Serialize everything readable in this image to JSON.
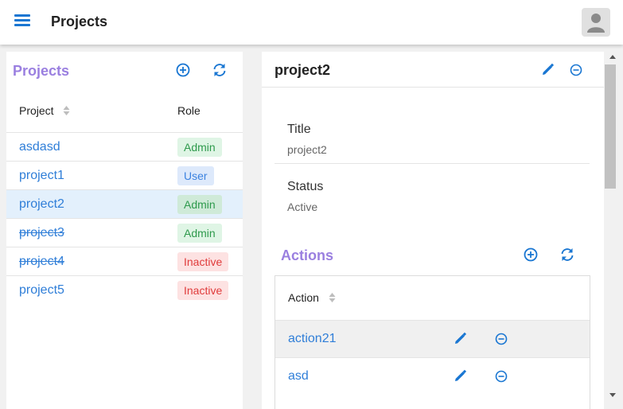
{
  "header": {
    "menu_icon": "hamburger-menu-icon",
    "title": "Projects",
    "avatar_icon": "user-avatar-icon"
  },
  "projects_panel": {
    "title": "Projects",
    "add_icon": "plus-circle-icon",
    "refresh_icon": "refresh-icon",
    "columns": {
      "project": "Project",
      "role": "Role"
    },
    "rows": [
      {
        "name": "asdasd",
        "role": "Admin",
        "role_type": "admin",
        "struck": false,
        "selected": false
      },
      {
        "name": "project1",
        "role": "User",
        "role_type": "user",
        "struck": false,
        "selected": false
      },
      {
        "name": "project2",
        "role": "Admin",
        "role_type": "admin",
        "struck": false,
        "selected": true
      },
      {
        "name": "project3",
        "role": "Admin",
        "role_type": "admin",
        "struck": true,
        "selected": false
      },
      {
        "name": "project4",
        "role": "Inactive",
        "role_type": "inactive",
        "struck": true,
        "selected": false
      },
      {
        "name": "project5",
        "role": "Inactive",
        "role_type": "inactive",
        "struck": false,
        "selected": false
      }
    ]
  },
  "detail": {
    "title": "project2",
    "edit_icon": "pencil-icon",
    "remove_icon": "minus-circle-icon",
    "fields": [
      {
        "label": "Title",
        "value": "project2"
      },
      {
        "label": "Status",
        "value": "Active"
      }
    ],
    "actions": {
      "title": "Actions",
      "add_icon": "plus-circle-icon",
      "refresh_icon": "refresh-icon",
      "column": "Action",
      "rows": [
        {
          "name": "action21",
          "highlighted": true
        },
        {
          "name": "asd",
          "highlighted": false
        }
      ]
    }
  },
  "colors": {
    "accent_blue": "#1976d2",
    "link_blue": "#2f7ed8",
    "section_title_purple": "#9a7fe0",
    "admin_green": "#2e9a4c",
    "inactive_red": "#e03b3b",
    "selected_row": "#e3f0fc"
  }
}
